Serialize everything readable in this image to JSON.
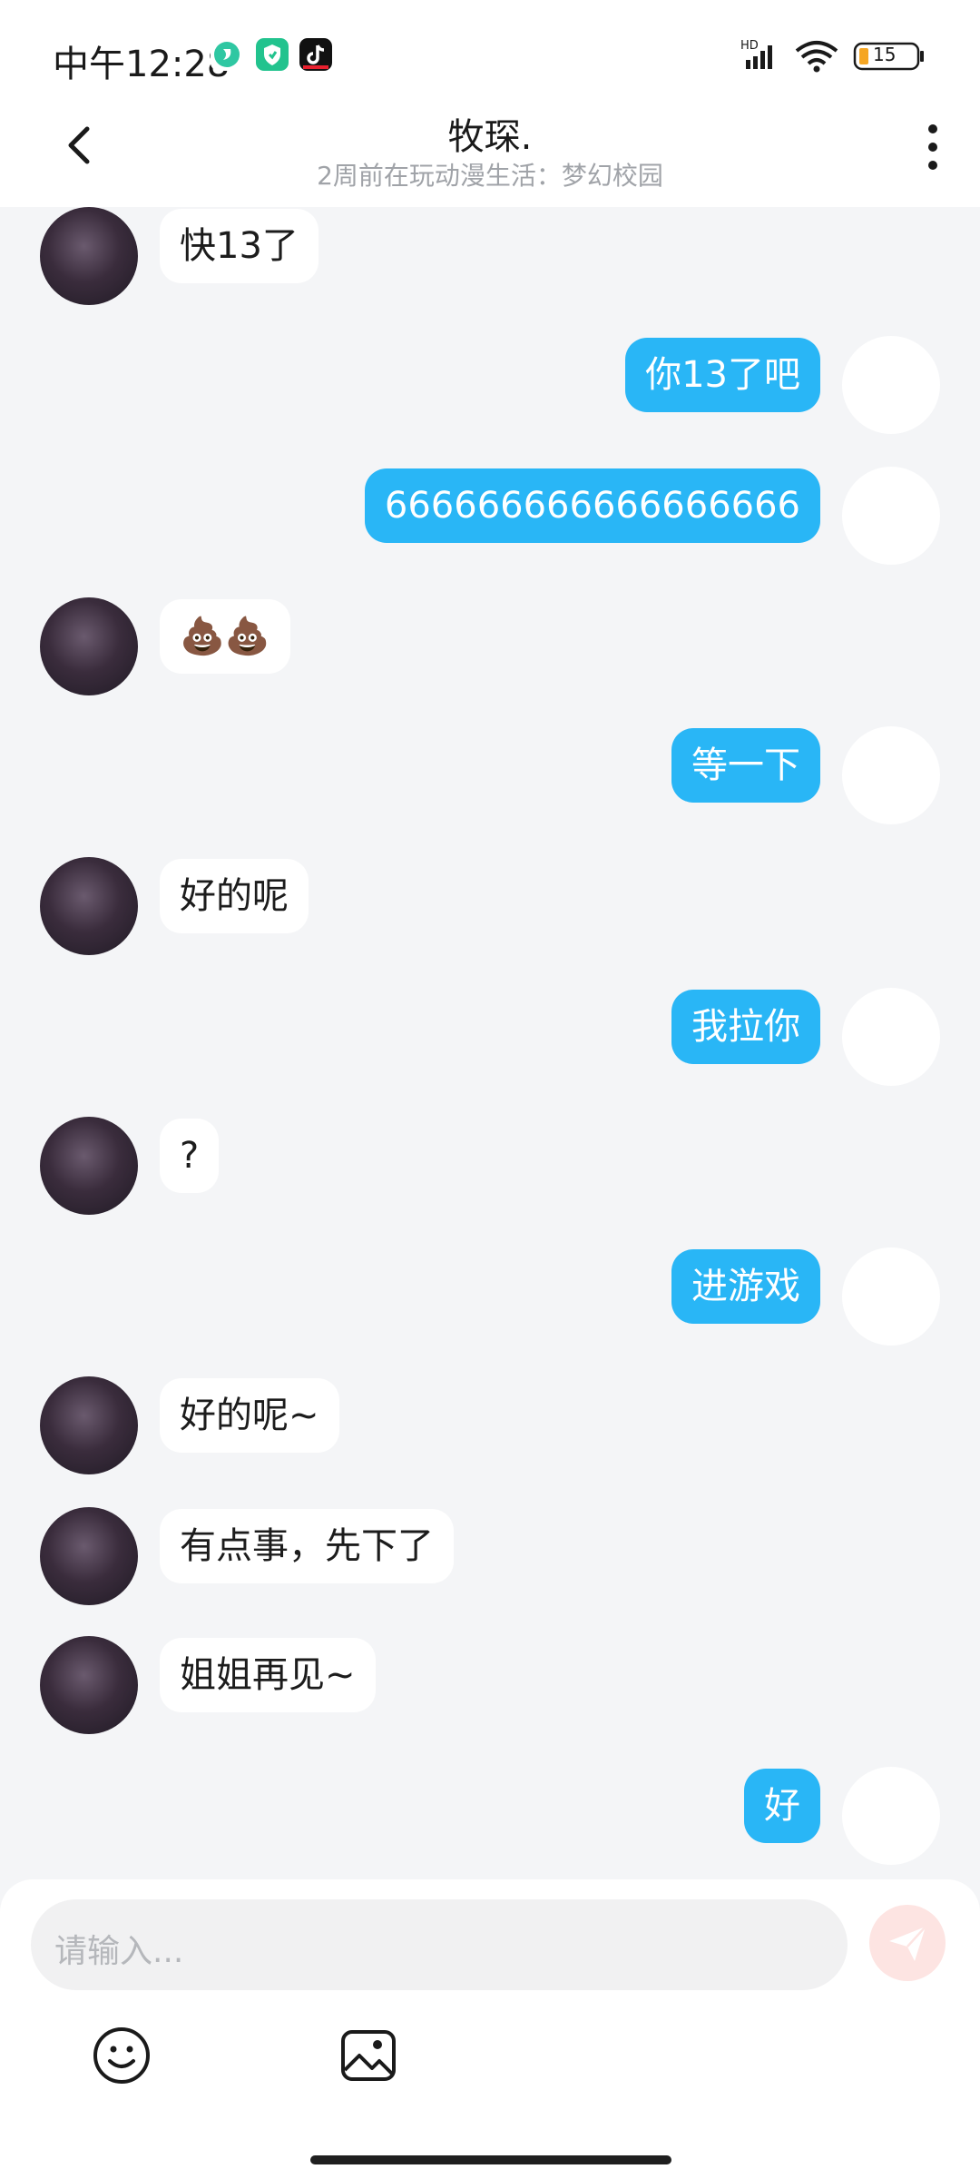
{
  "status_bar": {
    "time": "中午12:28",
    "network": "HD",
    "battery": "15"
  },
  "header": {
    "title": "牧琛.",
    "subtitle": "2周前在玩动漫生活：梦幻校园"
  },
  "messages": [
    {
      "side": "in",
      "text": "快13了"
    },
    {
      "side": "out",
      "text": "你13了吧"
    },
    {
      "side": "out",
      "text": "666666666666666666"
    },
    {
      "side": "in",
      "text": "💩💩"
    },
    {
      "side": "out",
      "text": "等一下"
    },
    {
      "side": "in",
      "text": "好的呢"
    },
    {
      "side": "out",
      "text": "我拉你"
    },
    {
      "side": "in",
      "text": "?"
    },
    {
      "side": "out",
      "text": "进游戏"
    },
    {
      "side": "in",
      "text": "好的呢~"
    },
    {
      "side": "in",
      "text": "有点事，先下了"
    },
    {
      "side": "in",
      "text": "姐姐再见~"
    },
    {
      "side": "out",
      "text": "好"
    }
  ],
  "composer": {
    "placeholder": "请输入..."
  },
  "icons": {
    "back": "chevron-left-icon",
    "more": "more-vertical-icon",
    "send": "send-icon",
    "emoji": "emoji-icon",
    "image": "image-icon"
  },
  "colors": {
    "outgoing_bubble": "#29b6f6",
    "incoming_bubble": "#ffffff",
    "background": "#f4f5f7",
    "send_button_disabled": "#fde4e2"
  }
}
